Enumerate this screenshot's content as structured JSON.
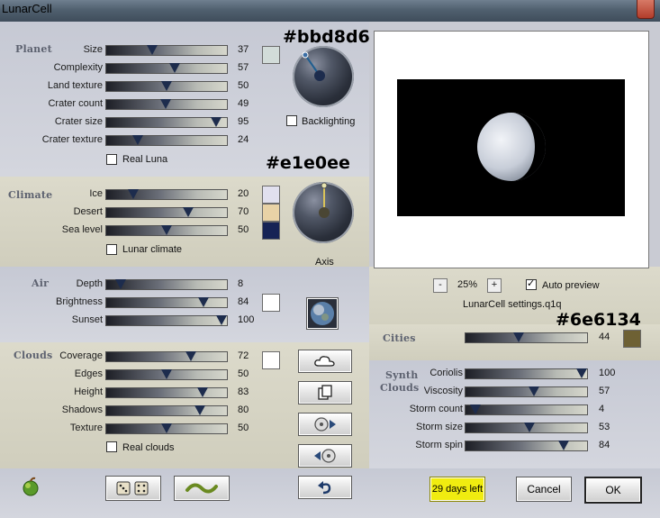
{
  "window": {
    "title": "LunarCell"
  },
  "planet": {
    "title": "Planet",
    "sliders": [
      {
        "label": "Size",
        "value": "37"
      },
      {
        "label": "Complexity",
        "value": "57"
      },
      {
        "label": "Land texture",
        "value": "50"
      },
      {
        "label": "Crater count",
        "value": "49"
      },
      {
        "label": "Crater size",
        "value": "95"
      },
      {
        "label": "Crater texture",
        "value": "24"
      }
    ],
    "real_luna_label": "Real Luna",
    "real_luna_checked": false,
    "color_hex_label": "#bbd8d6",
    "swatch_color": "#d2dcd9",
    "backlighting_label": "Backlighting",
    "backlighting_checked": false
  },
  "climate": {
    "title": "Climate",
    "sliders": [
      {
        "label": "Ice",
        "value": "20"
      },
      {
        "label": "Desert",
        "value": "70"
      },
      {
        "label": "Sea level",
        "value": "50"
      }
    ],
    "swatches": [
      "#e1e0ee",
      "#e8d2a6",
      "#162355"
    ],
    "lunar_climate_label": "Lunar climate",
    "lunar_climate_checked": false,
    "color_hex_label": "#e1e0ee",
    "axis_label": "Axis"
  },
  "air": {
    "title": "Air",
    "sliders": [
      {
        "label": "Depth",
        "value": "8"
      },
      {
        "label": "Brightness",
        "value": "84"
      },
      {
        "label": "Sunset",
        "value": "100"
      }
    ],
    "swatch_color": "#ffffff"
  },
  "clouds": {
    "title": "Clouds",
    "sliders": [
      {
        "label": "Coverage",
        "value": "72"
      },
      {
        "label": "Edges",
        "value": "50"
      },
      {
        "label": "Height",
        "value": "83"
      },
      {
        "label": "Shadows",
        "value": "80"
      },
      {
        "label": "Texture",
        "value": "50"
      }
    ],
    "swatch_color": "#ffffff",
    "real_clouds_label": "Real clouds",
    "real_clouds_checked": false
  },
  "preview": {
    "zoom": "25%",
    "minus": "-",
    "plus": "+",
    "auto_preview_label": "Auto preview",
    "auto_preview_checked": true,
    "settings_file": "LunarCell settings.q1q"
  },
  "cities": {
    "title": "Cities",
    "value": "44",
    "color_hex_label": "#6e6134",
    "swatch_color": "#6e6134"
  },
  "synth_clouds": {
    "title_line1": "Synth",
    "title_line2": "Clouds",
    "sliders": [
      {
        "label": "Coriolis",
        "value": "100"
      },
      {
        "label": "Viscosity",
        "value": "57"
      },
      {
        "label": "Storm count",
        "value": "4"
      },
      {
        "label": "Storm size",
        "value": "53"
      },
      {
        "label": "Storm spin",
        "value": "84"
      }
    ]
  },
  "bottom": {
    "trial_label": "29 days left",
    "cancel_label": "Cancel",
    "ok_label": "OK"
  },
  "colors": {
    "trial_bg": "#f0ec10",
    "accent_blue": "#1d2c4d"
  },
  "icons": [
    "apple-icon",
    "dice-icon",
    "wave-icon",
    "cloud-icon",
    "copy-icon",
    "disc-forward-icon",
    "disc-back-icon",
    "undo-icon",
    "planet-thumbnail-icon"
  ]
}
